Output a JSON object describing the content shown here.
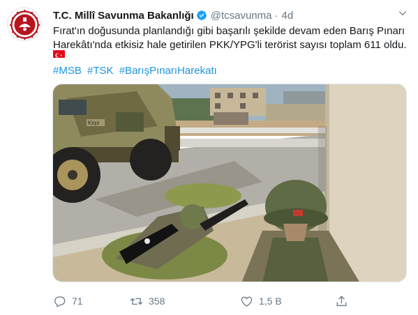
{
  "account": {
    "name": "T.C. Millî Savunma Bakanlığı",
    "handle": "@tcsavunma",
    "separator": "·",
    "time": "4d"
  },
  "tweet": {
    "text_line1": "Fırat'ın doğusunda planlandığı gibi başarılı şekilde devam eden Barış Pınarı",
    "text_line2": "Harekâtı'nda etkisiz hale getirilen PKK/YPG'li terörist sayısı toplam 611 oldu.",
    "hashtags": [
      "#MSB",
      "#TSK",
      "#BarışPınarıHarekatı"
    ]
  },
  "photo": {
    "vehicle_marking": "Kirpi"
  },
  "actions": {
    "reply_count": "71",
    "retweet_count": "358",
    "like_count": "1,5 B"
  },
  "colors": {
    "link": "#1b95e0",
    "muted": "#657786",
    "verified": "#1da1f2",
    "flag_red": "#e30a17"
  },
  "icons": {
    "verified": "verified-badge-icon",
    "caret": "chevron-down-icon",
    "reply": "reply-icon",
    "retweet": "retweet-icon",
    "like": "heart-icon",
    "share": "share-icon"
  }
}
